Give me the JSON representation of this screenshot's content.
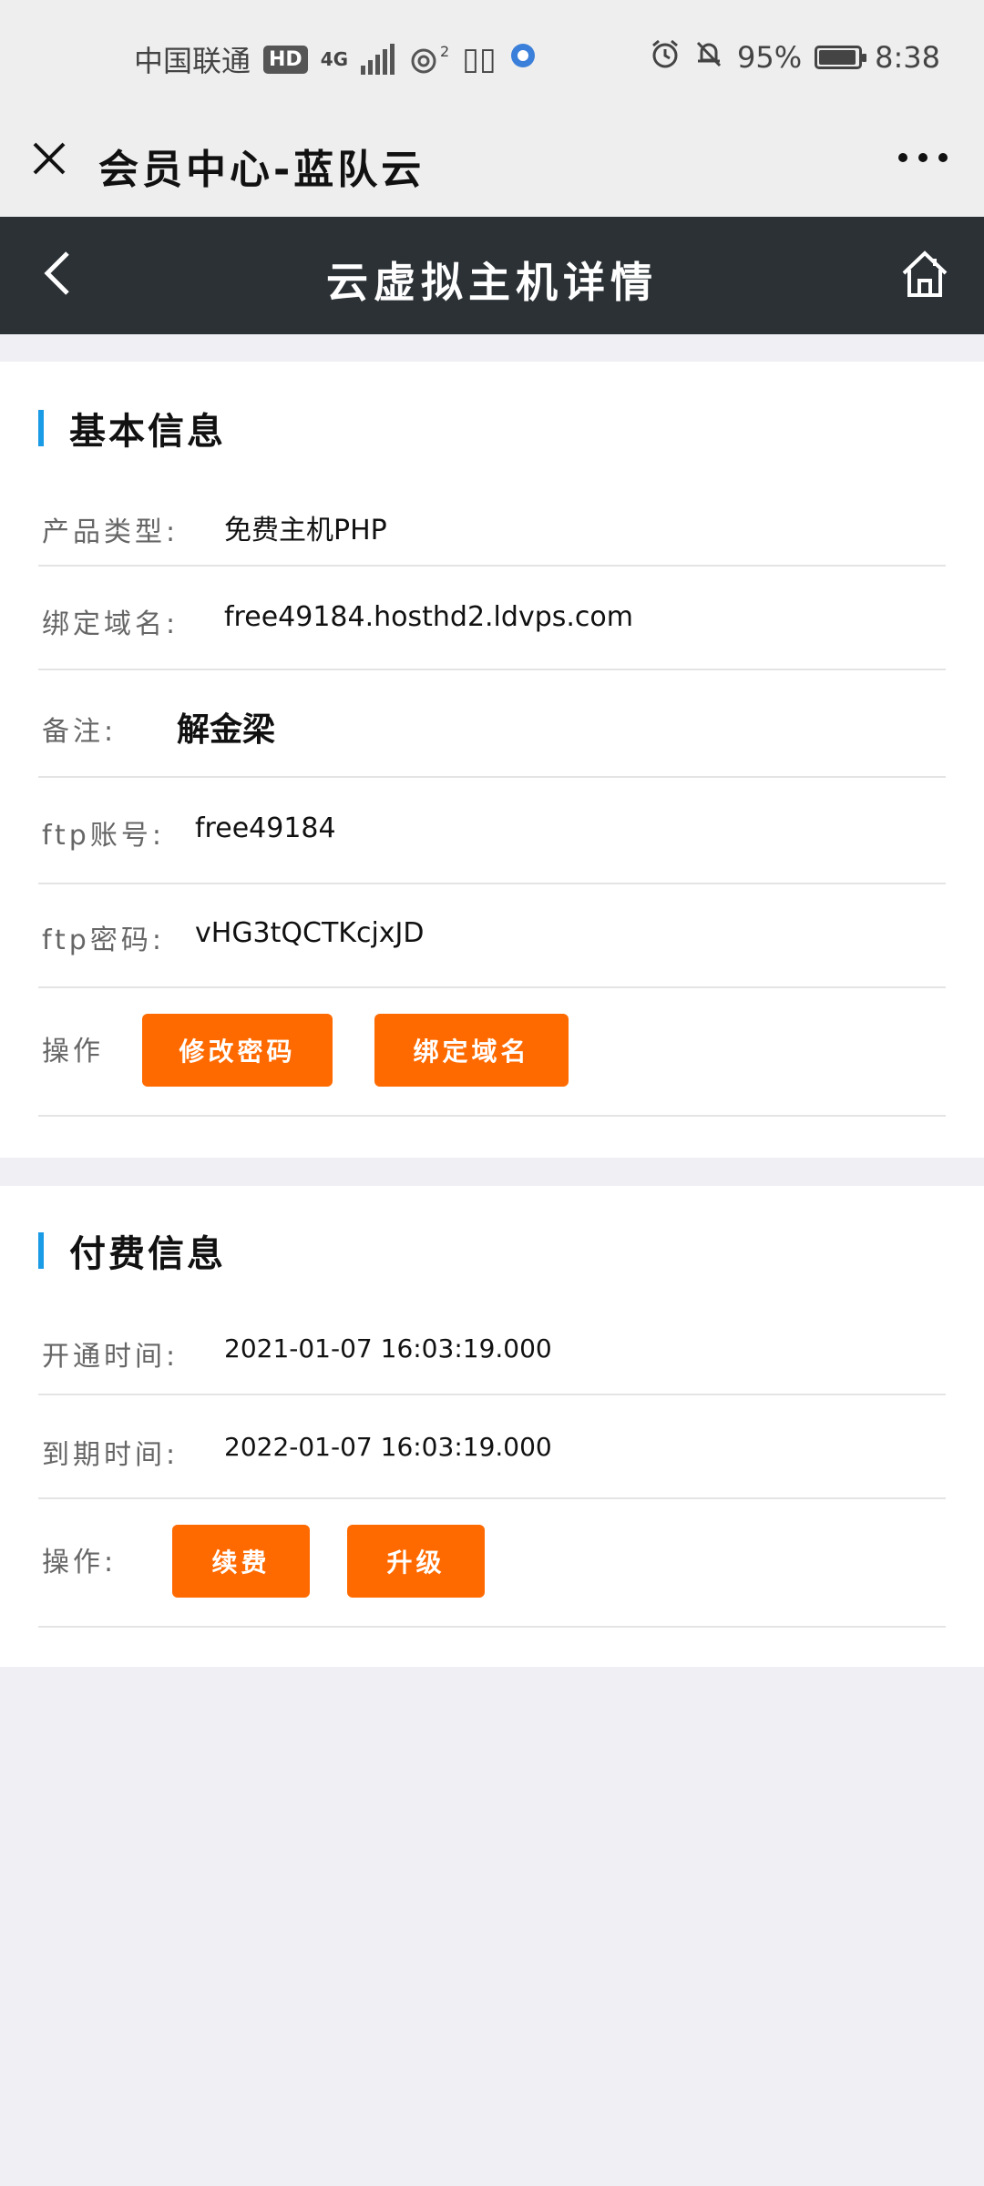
{
  "status_bar": {
    "carrier": "中国联通",
    "hd": "HD",
    "network": "4G",
    "nfc_label": "2",
    "battery_text": "95%",
    "battery_level": 0.95,
    "time": "8:38"
  },
  "wechat_bar": {
    "title": "会员中心-蓝队云"
  },
  "header": {
    "title": "云虚拟主机详情"
  },
  "basic_info": {
    "title": "基本信息",
    "rows": [
      {
        "label": "产品类型:",
        "value": "免费主机PHP"
      },
      {
        "label": "绑定域名:",
        "value": "free49184.hosthd2.ldvps.com"
      },
      {
        "label": "备注:",
        "value": "解金梁"
      },
      {
        "label": "ftp账号:",
        "value": "free49184"
      },
      {
        "label": "ftp密码:",
        "value": "vHG3tQCTKcjxJD"
      }
    ],
    "action_label": "操作",
    "buttons": [
      "修改密码",
      "绑定域名"
    ]
  },
  "payment_info": {
    "title": "付费信息",
    "rows": [
      {
        "label": "开通时间:",
        "value": "2021-01-07  16:03:19.000"
      },
      {
        "label": "到期时间:",
        "value": "2022-01-07  16:03:19.000"
      }
    ],
    "action_label": "操作:",
    "buttons": [
      "续费",
      "升级"
    ]
  },
  "colors": {
    "accent": "#1a9be6",
    "button": "#ff6a00",
    "header_bg": "#2b3135"
  }
}
